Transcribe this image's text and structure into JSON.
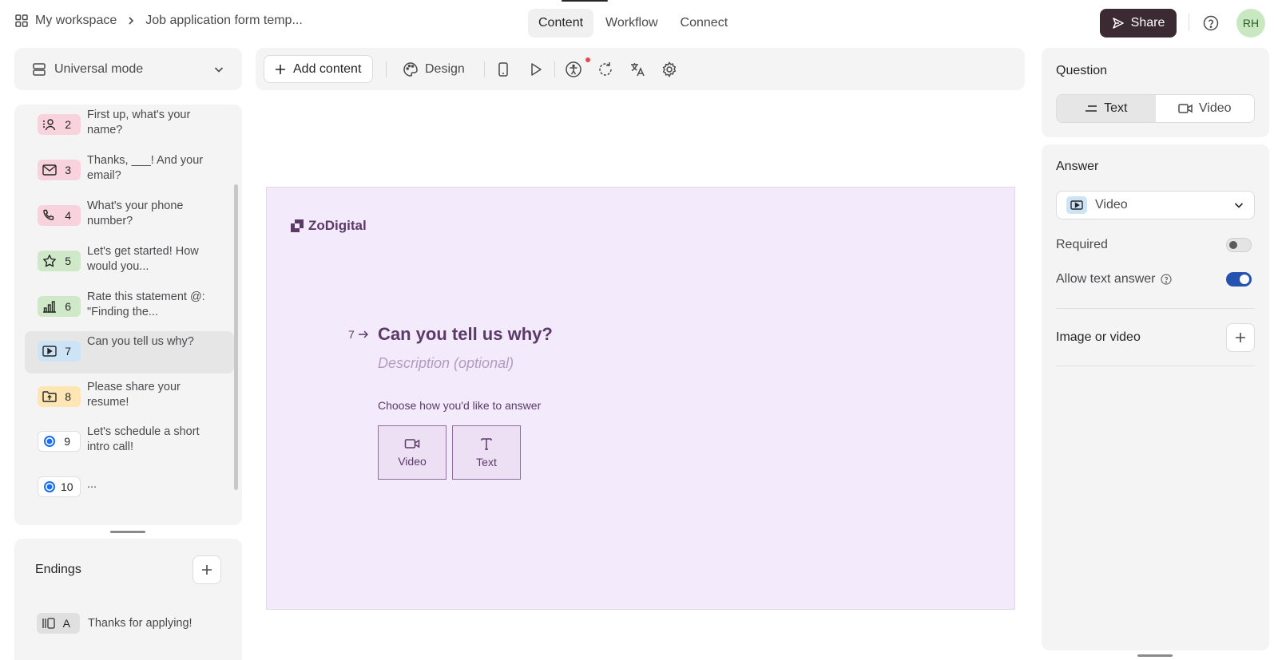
{
  "breadcrumb": {
    "workspace": "My workspace",
    "form": "Job application form temp..."
  },
  "tabs": [
    {
      "label": "Content"
    },
    {
      "label": "Workflow"
    },
    {
      "label": "Connect"
    }
  ],
  "share_label": "Share",
  "avatar_initials": "RH",
  "mode": {
    "label": "Universal mode"
  },
  "questions": [
    {
      "num": "2",
      "text": "First up, what's your name?",
      "icon": "contact-icon",
      "color": "#f8d2dc"
    },
    {
      "num": "3",
      "text": "Thanks, ___! And your email?",
      "icon": "mail-icon",
      "color": "#f8d2dc"
    },
    {
      "num": "4",
      "text": "What's your phone number?",
      "icon": "phone-icon",
      "color": "#f8d2dc"
    },
    {
      "num": "5",
      "text": "Let's get started! How would you...",
      "icon": "star-icon",
      "color": "#cfe8c7"
    },
    {
      "num": "6",
      "text": "Rate this statement @: \"Finding the...",
      "icon": "bar-chart-icon",
      "color": "#cfe8c7"
    },
    {
      "num": "7",
      "text": "Can you tell us why?",
      "icon": "video-icon",
      "color": "#cde4f7",
      "selected": true
    },
    {
      "num": "8",
      "text": "Please share your resume!",
      "icon": "upload-icon",
      "color": "#fde6b3"
    },
    {
      "num": "9",
      "text": "Let's schedule a short intro call!",
      "icon": "calendly-icon",
      "color": "#ffffff"
    },
    {
      "num": "10",
      "text": "...",
      "icon": "calendly-icon",
      "color": "#ffffff"
    }
  ],
  "endings": {
    "title": "Endings",
    "items": [
      {
        "letter": "A",
        "text": "Thanks for applying!"
      }
    ]
  },
  "toolbar": {
    "add_content": "Add content",
    "design": "Design"
  },
  "canvas": {
    "logo": "ZoDigital",
    "question_number": "7",
    "title": "Can you tell us why?",
    "description_placeholder": "Description (optional)",
    "choose_prompt": "Choose how you'd like to answer",
    "choices": [
      {
        "label": "Video"
      },
      {
        "label": "Text"
      }
    ],
    "colors": {
      "background": "#f3eafb",
      "text": "#5b3a68"
    }
  },
  "right_panel": {
    "question_title": "Question",
    "question_types": [
      {
        "label": "Text",
        "active": true
      },
      {
        "label": "Video",
        "active": false
      }
    ],
    "answer_title": "Answer",
    "answer_type": "Video",
    "required_label": "Required",
    "required": false,
    "allow_text_label": "Allow text answer",
    "allow_text": true,
    "media_label": "Image or video"
  }
}
